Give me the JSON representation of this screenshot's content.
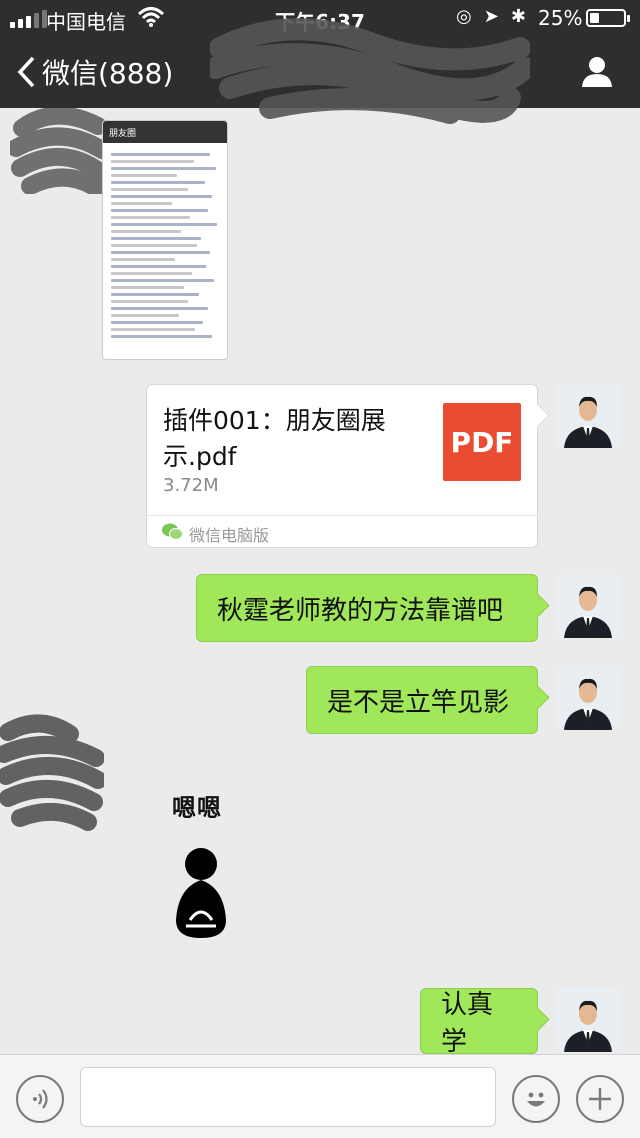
{
  "status_bar": {
    "carrier": "中国电信",
    "time": "下午6:37",
    "battery": "25%"
  },
  "nav": {
    "back_label": "微信(888)"
  },
  "messages": {
    "file": {
      "name": "插件001：朋友圈展示.pdf",
      "size": "3.72M",
      "type_label": "PDF",
      "source": "微信电脑版"
    },
    "text1": "秋霆老师教的方法靠谱吧",
    "text2": "是不是立竿见影",
    "reply": "嗯嗯",
    "text3": "认真学"
  },
  "thumbnail": {
    "title": "朋友圈"
  },
  "colors": {
    "bar": "#2e2e30",
    "bubble": "#a0e75a",
    "pdf": "#ea4c32"
  }
}
